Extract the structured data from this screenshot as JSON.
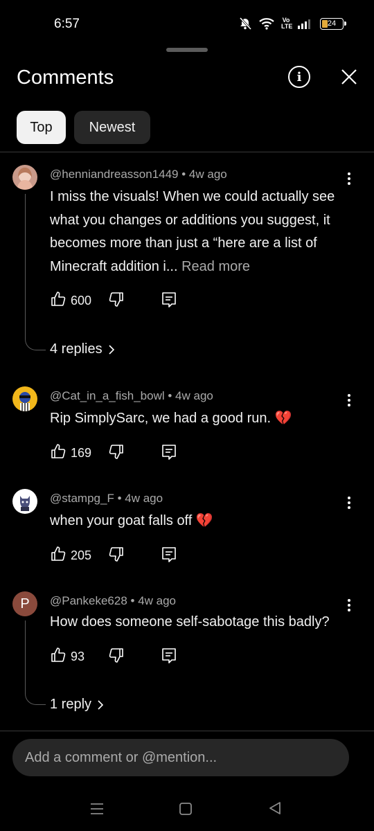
{
  "status_bar": {
    "time": "6:57",
    "volte": "Vo LTE",
    "battery": "24"
  },
  "header": {
    "title": "Comments"
  },
  "filters": [
    {
      "label": "Top",
      "selected": true
    },
    {
      "label": "Newest",
      "selected": false
    }
  ],
  "comments": [
    {
      "author": "@henniandreasson1449",
      "time": "4w ago",
      "text": "I miss the visuals! When we could actually see what you changes or additions you suggest, it becomes more than just a “here are a list of Minecraft addition i...",
      "read_more": "Read more",
      "likes": "600",
      "replies": "4 replies"
    },
    {
      "author": "@Cat_in_a_fish_bowl",
      "time": "4w ago",
      "text": "Rip SimplySarc, we had a good run.",
      "emoji": "💔",
      "likes": "169"
    },
    {
      "author": "@stampg_F",
      "time": "4w ago",
      "text": "when your goat falls off",
      "emoji": "💔",
      "likes": "205"
    },
    {
      "author": "@Pankeke628",
      "avatar_letter": "P",
      "time": "4w ago",
      "text": "How does someone self-sabotage this badly?",
      "likes": "93",
      "replies": "1 reply"
    }
  ],
  "composer": {
    "placeholder": "Add a comment or @mention..."
  },
  "colors": {
    "background": "#000000",
    "chip_selected": "#f1f1f1",
    "chip": "#272727",
    "secondary_text": "#aaaaaa",
    "avatar_p": "#8a4a3c"
  }
}
